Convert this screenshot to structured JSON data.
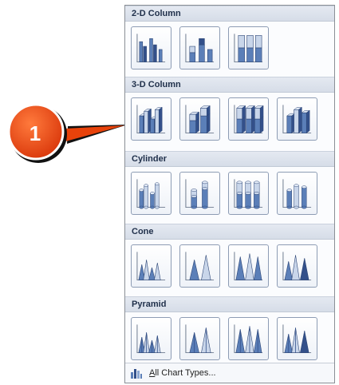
{
  "callout": {
    "number": "1",
    "color": "#e8420a"
  },
  "gallery": {
    "sections": [
      {
        "title": "2-D Column",
        "items": [
          {
            "name": "clustered-column",
            "style": "2d-clustered"
          },
          {
            "name": "stacked-column",
            "style": "2d-stacked"
          },
          {
            "name": "100-stacked-column",
            "style": "2d-100"
          }
        ]
      },
      {
        "title": "3-D Column",
        "items": [
          {
            "name": "3d-clustered-column",
            "style": "3d-clustered"
          },
          {
            "name": "3d-stacked-column",
            "style": "3d-stacked"
          },
          {
            "name": "3d-100-stacked-column",
            "style": "3d-100"
          },
          {
            "name": "3d-column",
            "style": "3d-column"
          }
        ]
      },
      {
        "title": "Cylinder",
        "items": [
          {
            "name": "clustered-cylinder",
            "style": "cyl-clustered"
          },
          {
            "name": "stacked-cylinder",
            "style": "cyl-stacked"
          },
          {
            "name": "100-stacked-cylinder",
            "style": "cyl-100"
          },
          {
            "name": "3d-cylinder",
            "style": "cyl-3d"
          }
        ]
      },
      {
        "title": "Cone",
        "items": [
          {
            "name": "clustered-cone",
            "style": "cone-clustered"
          },
          {
            "name": "stacked-cone",
            "style": "cone-stacked"
          },
          {
            "name": "100-stacked-cone",
            "style": "cone-100"
          },
          {
            "name": "3d-cone",
            "style": "cone-3d"
          }
        ]
      },
      {
        "title": "Pyramid",
        "items": [
          {
            "name": "clustered-pyramid",
            "style": "pyr-clustered"
          },
          {
            "name": "stacked-pyramid",
            "style": "pyr-stacked"
          },
          {
            "name": "100-stacked-pyramid",
            "style": "pyr-100"
          },
          {
            "name": "3d-pyramid",
            "style": "pyr-3d"
          }
        ]
      }
    ],
    "footer": {
      "label_first": "A",
      "label_rest": "ll Chart Types..."
    }
  },
  "colors": {
    "accent": "#5b7fb8",
    "light": "#c9d6ea",
    "dark": "#33508a"
  }
}
